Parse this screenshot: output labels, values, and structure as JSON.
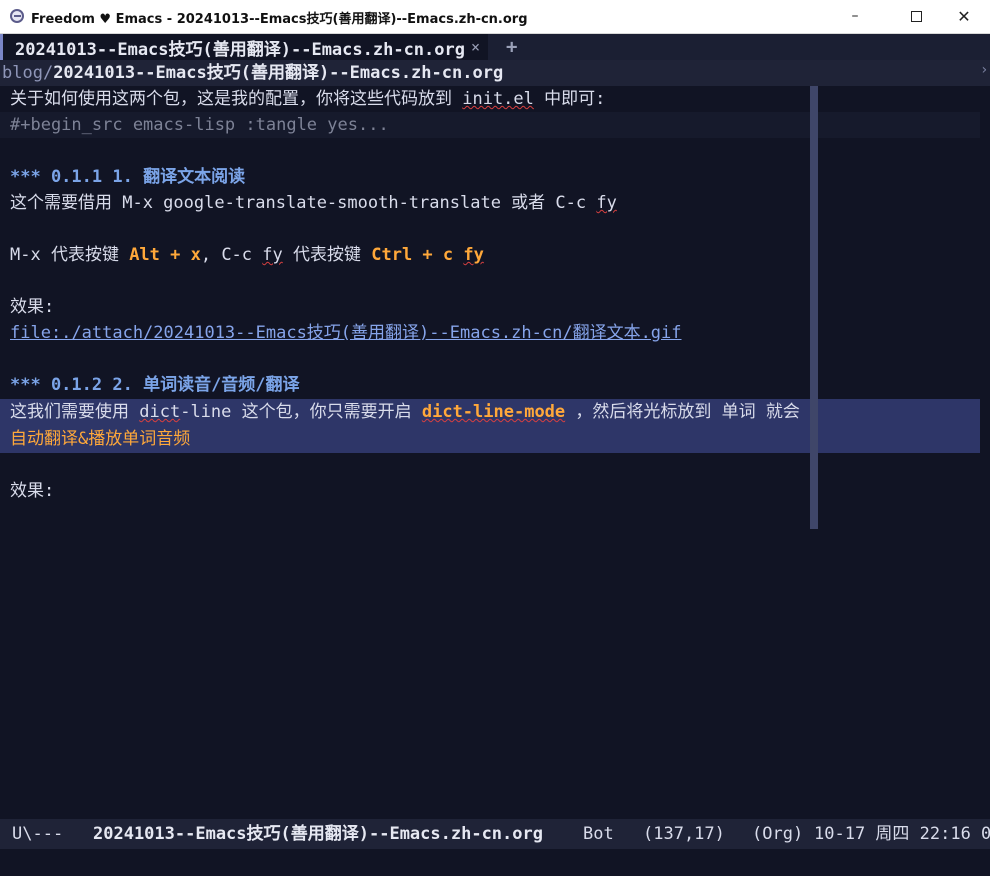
{
  "window": {
    "title_prefix": "Freedom",
    "heart_glyph": "♥",
    "title_suffix": "Emacs - 20241013--Emacs技巧(善用翻译)--Emacs.zh-cn.org",
    "minimize_glyph": "–",
    "close_glyph": "✕"
  },
  "tabs": {
    "active_label": "20241013--Emacs技巧(善用翻译)--Emacs.zh-cn.org",
    "close_glyph": "×",
    "add_glyph": "+"
  },
  "header": {
    "dir": "blog/",
    "file": "20241013--Emacs技巧(善用翻译)--Emacs.zh-cn.org",
    "edge_glyph": "›"
  },
  "buffer": {
    "line1_a": "关于如何使用这两个包，这是我的配置，你将这些代码放到 ",
    "line1_b": "init.el",
    "line1_c": " 中即可:",
    "line2": "#+begin_src emacs-lisp :tangle yes...",
    "h1_stars": "*** 0.1.1 1.",
    "h1_title": " 翻译文本阅读",
    "line4_a": "这个需要借用 M-x google-translate-smooth-translate 或者 C-c ",
    "line4_b": "fy",
    "line5_a": "M-x 代表按键 ",
    "line5_key1": "Alt + x",
    "line5_b": ", C-c ",
    "line5_c": "fy",
    "line5_d": " 代表按键 ",
    "line5_key2a": "Ctrl + c ",
    "line5_key2b": "fy",
    "line6": "效果:",
    "line7_link": "file:./attach/20241013--Emacs技巧(善用翻译)--Emacs.zh-cn/翻译文本.gif",
    "h2_stars": "*** 0.1.2 2.",
    "h2_title": " 单词读音/音频/翻译",
    "line9_a": "这我们需要使用 ",
    "line9_b": "dict",
    "line9_c": "-line 这个包，你只需要开启 ",
    "line9_key": "dict-line-mode",
    "line9_d": " ，然后将光标放到 单词 就会",
    "line10": "自动翻译&播放单词音频",
    "line11": "效果:"
  },
  "modeline": {
    "state": "U\\---",
    "buffer_name": "20241013--Emacs技巧(善用翻译)--Emacs.zh-cn.org",
    "position": "Bot",
    "line_col": "(137,17)",
    "mode": "(Org)",
    "datetime": "10-17 周四 22:16 0"
  },
  "colors": {
    "background": "#111424",
    "heading": "#7ba4e8",
    "keyword": "#ffa83a",
    "region": "#2e3668"
  }
}
